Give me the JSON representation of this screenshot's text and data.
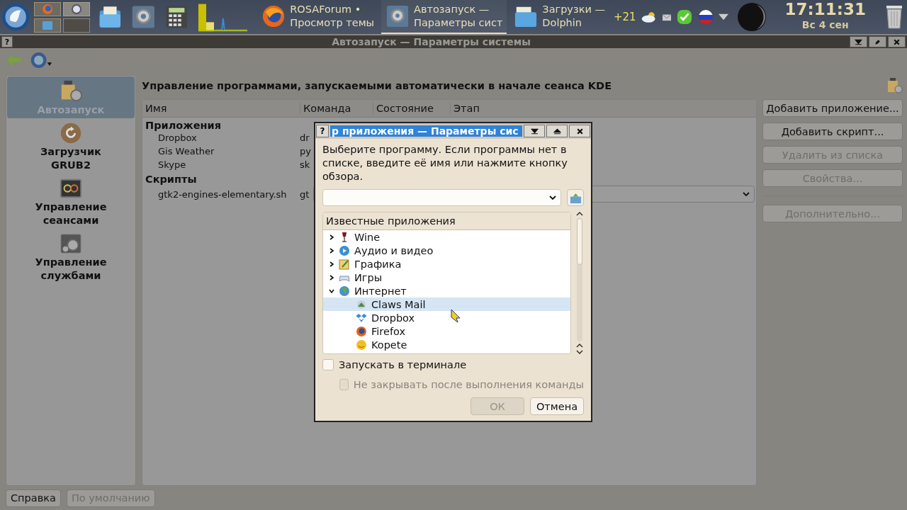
{
  "taskbar": {
    "tasks": [
      {
        "line1": "ROSAForum •",
        "line2": "Просмотр темы",
        "kind": "browser",
        "selected": false
      },
      {
        "line1": "Автозапуск —",
        "line2": "Параметры сист",
        "kind": "settings",
        "selected": true
      },
      {
        "line1": "Загрузки —",
        "line2": "Dolphin",
        "kind": "folder",
        "selected": false
      }
    ],
    "weather_temp": "+21",
    "clock": {
      "time": "17:11:31",
      "date": "Вс  4 сен"
    }
  },
  "window": {
    "help_button": "?",
    "title": "Автозапуск — Параметры системы"
  },
  "sidebar": {
    "items": [
      {
        "label": "Автозапуск",
        "kind": "autostart",
        "selected": true
      },
      {
        "label": "Загрузчик GRUB2",
        "kind": "grub",
        "selected": false
      },
      {
        "label": "Управление сеансами",
        "kind": "sessions",
        "selected": false
      },
      {
        "label": "Управление службами",
        "kind": "services",
        "selected": false
      }
    ]
  },
  "heading": "Управление программами, запускаемыми автоматически в начале сеанса KDE",
  "table": {
    "columns": [
      "Имя",
      "Команда",
      "Состояние",
      "Этап"
    ],
    "groups": [
      {
        "name": "Приложения",
        "rows": [
          {
            "name": "Dropbox",
            "command": "dr",
            "kind": "plain"
          },
          {
            "name": "Gis Weather",
            "command": "py",
            "kind": "plain"
          },
          {
            "name": "Skype",
            "command": "sk",
            "kind": "plain"
          }
        ]
      },
      {
        "name": "Скрипты",
        "rows": [
          {
            "name": "gtk2-engines-elementary.sh",
            "command": "gt",
            "kind": "combo"
          }
        ]
      }
    ]
  },
  "actions": [
    {
      "label": "Добавить приложение...",
      "disabled": false
    },
    {
      "label": "Добавить скрипт...",
      "disabled": false
    },
    {
      "label": "Удалить из списка",
      "disabled": true
    },
    {
      "label": "Свойства...",
      "disabled": true
    },
    {
      "label": "Дополнительно...",
      "disabled": true
    }
  ],
  "footer": [
    {
      "label": "Справка",
      "disabled": false
    },
    {
      "label": "По умолчанию",
      "disabled": true
    }
  ],
  "dialog": {
    "help_button": "?",
    "title": "р приложения — Параметры сис",
    "instruction": "Выберите программу. Если программы нет в списке, введите её имя или нажмите кнопку обзора.",
    "tree_header": "Известные приложения",
    "tree": [
      {
        "label": "Wine",
        "kind": "wine",
        "expanded": false,
        "selected": false
      },
      {
        "label": "Аудио и видео",
        "kind": "media",
        "expanded": false,
        "selected": false
      },
      {
        "label": "Графика",
        "kind": "graphics",
        "expanded": false,
        "selected": false
      },
      {
        "label": "Игры",
        "kind": "games",
        "expanded": false,
        "selected": false
      },
      {
        "label": "Интернет",
        "kind": "internet",
        "expanded": true,
        "selected": false,
        "children": [
          {
            "label": "Claws Mail",
            "kind": "mail",
            "selected": true
          },
          {
            "label": "Dropbox",
            "kind": "dropbox",
            "selected": false
          },
          {
            "label": "Firefox",
            "kind": "firefox",
            "selected": false
          },
          {
            "label": "Kopete",
            "kind": "kopete",
            "selected": false
          }
        ]
      }
    ],
    "checkboxes": [
      {
        "label": "Запускать в терминале",
        "checked": false,
        "disabled": false
      },
      {
        "label": "Не закрывать после выполнения команды",
        "checked": false,
        "disabled": true
      }
    ],
    "buttons": [
      {
        "label": "ОК",
        "disabled": true
      },
      {
        "label": "Отмена",
        "disabled": false
      }
    ]
  }
}
